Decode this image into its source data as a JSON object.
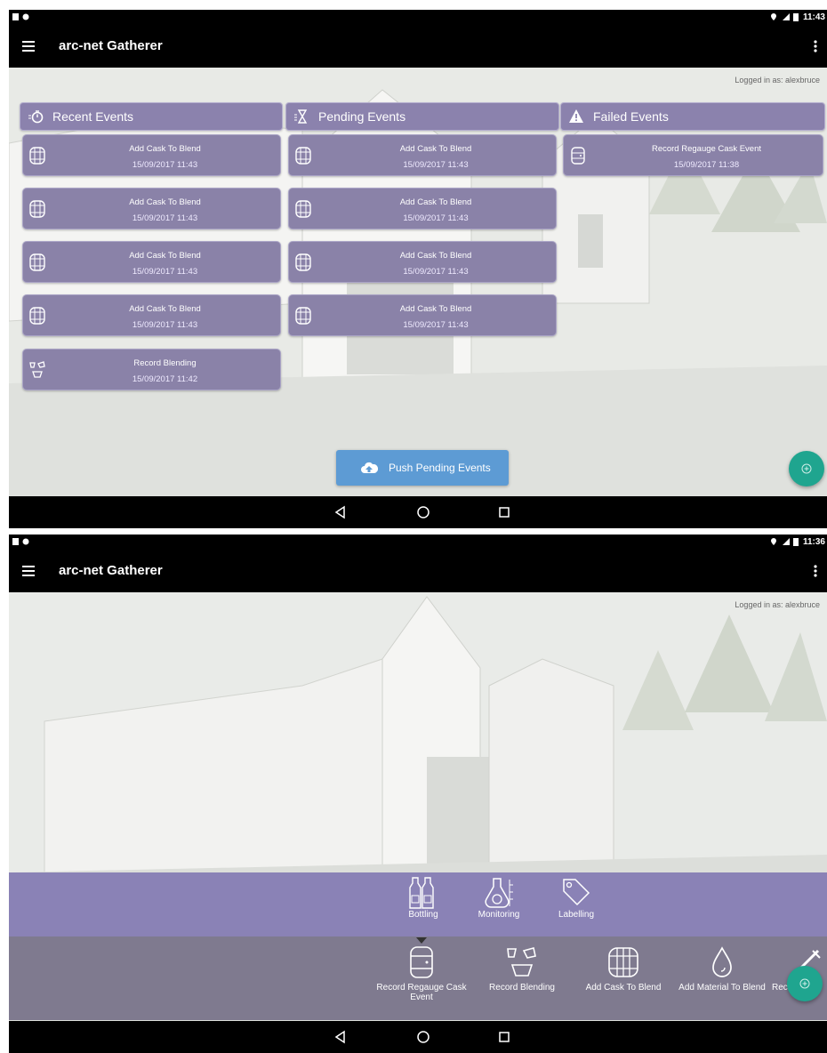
{
  "screen1": {
    "status_time": "11:43",
    "status_network": "LTE",
    "app_title": "arc-net Gatherer",
    "logged_in": "Logged in as: alexbruce",
    "columns": {
      "recent": {
        "title": "Recent Events",
        "icon": "timer-icon"
      },
      "pending": {
        "title": "Pending Events",
        "icon": "hourglass-icon"
      },
      "failed": {
        "title": "Failed Events",
        "icon": "warning-icon"
      }
    },
    "recent_events": [
      {
        "title": "Add Cask To Blend",
        "time": "15/09/2017 11:43",
        "icon": "barrel-icon"
      },
      {
        "title": "Add Cask To Blend",
        "time": "15/09/2017 11:43",
        "icon": "barrel-icon"
      },
      {
        "title": "Add Cask To Blend",
        "time": "15/09/2017 11:43",
        "icon": "barrel-icon"
      },
      {
        "title": "Add Cask To Blend",
        "time": "15/09/2017 11:43",
        "icon": "barrel-icon"
      },
      {
        "title": "Record Blending",
        "time": "15/09/2017 11:42",
        "icon": "blending-icon"
      }
    ],
    "pending_events": [
      {
        "title": "Add Cask To Blend",
        "time": "15/09/2017 11:43",
        "icon": "barrel-icon"
      },
      {
        "title": "Add Cask To Blend",
        "time": "15/09/2017 11:43",
        "icon": "barrel-icon"
      },
      {
        "title": "Add Cask To Blend",
        "time": "15/09/2017 11:43",
        "icon": "barrel-icon"
      },
      {
        "title": "Add Cask To Blend",
        "time": "15/09/2017 11:43",
        "icon": "barrel-icon"
      }
    ],
    "failed_events": [
      {
        "title": "Record Regauge Cask Event",
        "time": "15/09/2017 11:38",
        "icon": "regauge-icon"
      }
    ],
    "push_button": "Push Pending Events"
  },
  "screen2": {
    "status_time": "11:36",
    "status_network": "LTE",
    "app_title": "arc-net Gatherer",
    "logged_in": "Logged in as: alexbruce",
    "categories": [
      {
        "label": "Bottling",
        "icon": "bottles-icon"
      },
      {
        "label": "Monitoring",
        "icon": "flask-icon"
      },
      {
        "label": "Labelling",
        "icon": "tag-icon"
      }
    ],
    "event_types": [
      {
        "label_line1": "Record Regauge Cask",
        "label_line2": "Event",
        "icon": "regauge-icon",
        "selected": true
      },
      {
        "label_line1": "Record Blending",
        "label_line2": "",
        "icon": "blending-icon"
      },
      {
        "label_line1": "Add Cask To Blend",
        "label_line2": "",
        "icon": "barrel-icon"
      },
      {
        "label_line1": "Add Material To Blend",
        "label_line2": "",
        "icon": "drop-icon"
      },
      {
        "label_line1": "Rec",
        "label_line2": "",
        "icon": "pen-icon"
      }
    ]
  },
  "colors": {
    "card": "#8a82a8",
    "header": "#8b82ad",
    "accent_fab": "#1fa58f",
    "push_button": "#5d9bd4",
    "category_strip": "#8a82b6",
    "event_strip": "#7f7a8f"
  }
}
